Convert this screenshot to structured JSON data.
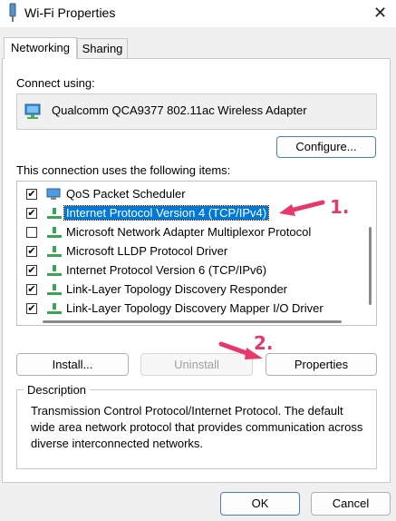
{
  "window": {
    "title": "Wi-Fi Properties",
    "icon": "wifi-adapter-icon",
    "close_glyph": "✕"
  },
  "tabs": [
    {
      "label": "Networking",
      "active": true
    },
    {
      "label": "Sharing",
      "active": false
    }
  ],
  "connect_using": {
    "label": "Connect using:",
    "adapter_name": "Qualcomm QCA9377 802.11ac Wireless Adapter",
    "adapter_icon": "network-adapter-icon"
  },
  "buttons": {
    "configure": "Configure...",
    "install": "Install...",
    "uninstall": "Uninstall",
    "properties": "Properties",
    "ok": "OK",
    "cancel": "Cancel"
  },
  "items_label": "This connection uses the following items:",
  "items": [
    {
      "label": "QoS Packet Scheduler",
      "checked": true,
      "selected": false,
      "icon": "scheduler-icon"
    },
    {
      "label": "Internet Protocol Version 4 (TCP/IPv4)",
      "checked": true,
      "selected": true,
      "icon": "protocol-icon"
    },
    {
      "label": "Microsoft Network Adapter Multiplexor Protocol",
      "checked": false,
      "selected": false,
      "icon": "protocol-icon"
    },
    {
      "label": "Microsoft LLDP Protocol Driver",
      "checked": true,
      "selected": false,
      "icon": "protocol-icon"
    },
    {
      "label": "Internet Protocol Version 6 (TCP/IPv6)",
      "checked": true,
      "selected": false,
      "icon": "protocol-icon"
    },
    {
      "label": "Link-Layer Topology Discovery Responder",
      "checked": true,
      "selected": false,
      "icon": "protocol-icon"
    },
    {
      "label": "Link-Layer Topology Discovery Mapper I/O Driver",
      "checked": true,
      "selected": false,
      "icon": "protocol-icon"
    }
  ],
  "description": {
    "legend": "Description",
    "text": "Transmission Control Protocol/Internet Protocol. The default wide area network protocol that provides communication across diverse interconnected networks."
  },
  "annotations": [
    {
      "label": "1.",
      "color": "#e8386a"
    },
    {
      "label": "2.",
      "color": "#e8386a"
    }
  ],
  "colors": {
    "selection": "#0078d7",
    "annotation": "#e8386a",
    "window_bg": "#f0f0f0"
  }
}
